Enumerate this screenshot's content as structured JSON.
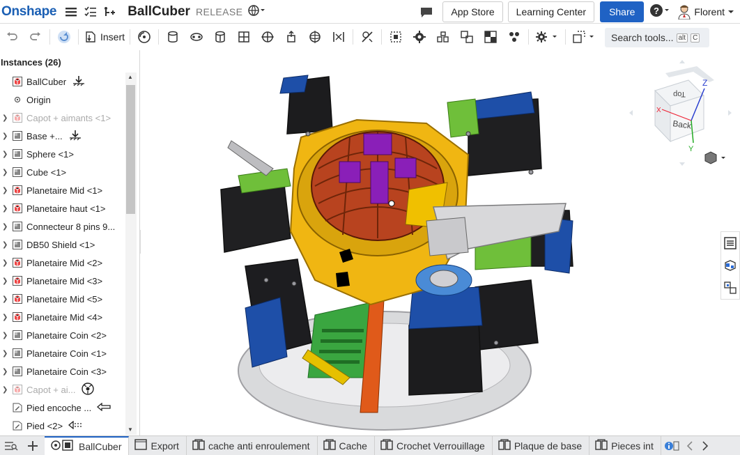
{
  "app": {
    "name": "Onshape"
  },
  "document": {
    "title": "BallCuber",
    "badge": "RELEASE"
  },
  "top_right": {
    "app_store": "App Store",
    "learning_center": "Learning Center",
    "share": "Share",
    "user_name": "Florent"
  },
  "toolbar": {
    "insert_label": "Insert",
    "search_label": "Search tools...",
    "search_kbd_1": "alt",
    "search_kbd_2": "C"
  },
  "instances": {
    "header": "Instances (26)",
    "items": [
      {
        "label": "BallCuber",
        "type": "assembly",
        "expandable": false,
        "faded": false,
        "badge": "fixed-icon"
      },
      {
        "label": "Origin",
        "type": "origin",
        "expandable": false,
        "faded": false,
        "badge": ""
      },
      {
        "label": "Capot + aimants <1>",
        "type": "assembly",
        "expandable": true,
        "faded": true,
        "badge": ""
      },
      {
        "label": "Base +...",
        "type": "part",
        "expandable": true,
        "faded": false,
        "badge": "fixed-icon"
      },
      {
        "label": "Sphere <1>",
        "type": "part",
        "expandable": true,
        "faded": false,
        "badge": ""
      },
      {
        "label": "Cube <1>",
        "type": "part",
        "expandable": true,
        "faded": false,
        "badge": ""
      },
      {
        "label": "Planetaire Mid <1>",
        "type": "assembly",
        "expandable": true,
        "faded": false,
        "badge": ""
      },
      {
        "label": "Planetaire haut <1>",
        "type": "assembly",
        "expandable": true,
        "faded": false,
        "badge": ""
      },
      {
        "label": "Connecteur 8 pins 9...",
        "type": "part",
        "expandable": true,
        "faded": false,
        "badge": ""
      },
      {
        "label": "DB50 Shield <1>",
        "type": "part",
        "expandable": true,
        "faded": false,
        "badge": ""
      },
      {
        "label": "Planetaire Mid <2>",
        "type": "assembly",
        "expandable": true,
        "faded": false,
        "badge": ""
      },
      {
        "label": "Planetaire Mid <3>",
        "type": "assembly",
        "expandable": true,
        "faded": false,
        "badge": ""
      },
      {
        "label": "Planetaire Mid <5>",
        "type": "assembly",
        "expandable": true,
        "faded": false,
        "badge": ""
      },
      {
        "label": "Planetaire Mid <4>",
        "type": "assembly",
        "expandable": true,
        "faded": false,
        "badge": ""
      },
      {
        "label": "Planetaire Coin <2>",
        "type": "part",
        "expandable": true,
        "faded": false,
        "badge": ""
      },
      {
        "label": "Planetaire Coin <1>",
        "type": "part",
        "expandable": true,
        "faded": false,
        "badge": ""
      },
      {
        "label": "Planetaire Coin <3>",
        "type": "part",
        "expandable": true,
        "faded": false,
        "badge": ""
      },
      {
        "label": "Capot + ai...",
        "type": "assembly",
        "expandable": true,
        "faded": true,
        "badge": "mate-icon"
      },
      {
        "label": "Pied encoche ...",
        "type": "sketch",
        "expandable": false,
        "faded": false,
        "badge": "arrow-icon"
      },
      {
        "label": "Pied <2>",
        "type": "sketch",
        "expandable": false,
        "faded": false,
        "badge": "dashed-arrow-icon"
      }
    ]
  },
  "viewcube": {
    "top": "Top",
    "back": "Back",
    "axis_x": "X",
    "axis_y": "Y",
    "axis_z": "Z"
  },
  "tabs": [
    {
      "label": "BallCuber",
      "icon": "assembly-icon",
      "active": true
    },
    {
      "label": "Export",
      "icon": "drawing-icon",
      "active": false
    },
    {
      "label": "cache anti enroulement",
      "icon": "part-studio-icon",
      "active": false
    },
    {
      "label": "Cache",
      "icon": "part-studio-icon",
      "active": false
    },
    {
      "label": "Crochet Verrouillage",
      "icon": "part-studio-icon",
      "active": false
    },
    {
      "label": "Plaque de base",
      "icon": "part-studio-icon",
      "active": false
    },
    {
      "label": "Pieces int",
      "icon": "part-studio-icon",
      "active": false
    }
  ],
  "colors": {
    "accent": "#1f62c4",
    "brand": "#1a5fb4"
  }
}
